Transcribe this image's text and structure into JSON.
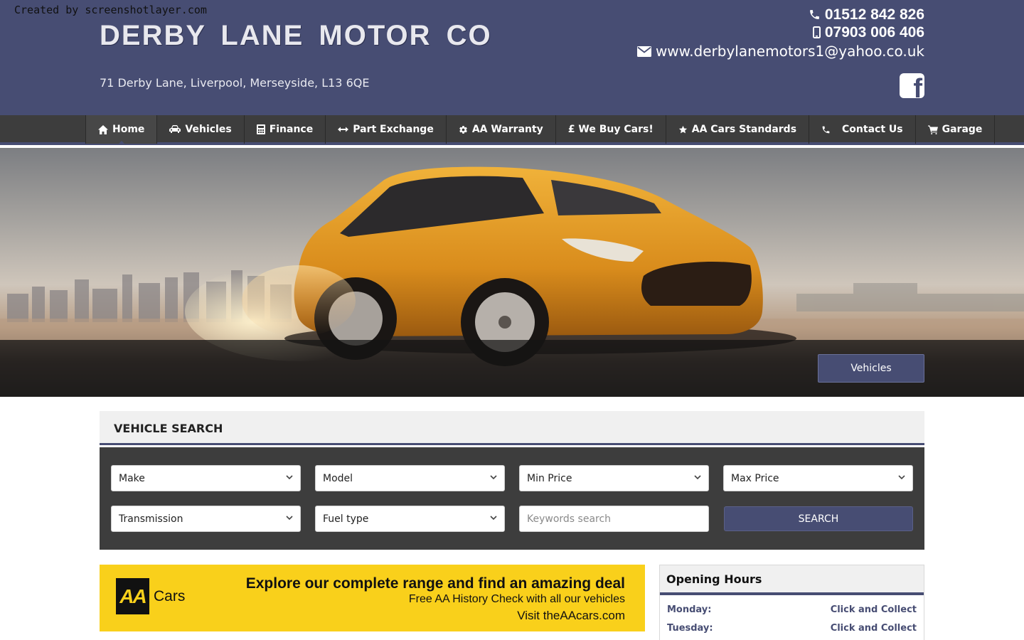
{
  "watermark": "Created by screenshotlayer.com",
  "header": {
    "logo": "DERBY LANE MOTOR CO",
    "address": "71 Derby Lane, Liverpool, Merseyside, L13 6QE",
    "phone1": "01512 842 826",
    "phone2": "07903 006 406",
    "email": "www.derbylanemotors1@yahoo.co.uk",
    "facebook_icon": "facebook-icon"
  },
  "nav": {
    "items": [
      {
        "label": "Home",
        "icon": "home-icon"
      },
      {
        "label": "Vehicles",
        "icon": "car-icon"
      },
      {
        "label": "Finance",
        "icon": "calculator-icon"
      },
      {
        "label": "Part Exchange",
        "icon": "exchange-icon"
      },
      {
        "label": "AA Warranty",
        "icon": "gear-icon"
      },
      {
        "label": "£ We Buy Cars!",
        "icon": ""
      },
      {
        "label": "AA Cars Standards",
        "icon": "star-icon"
      },
      {
        "label": "Contact Us",
        "icon": "phone-icon"
      },
      {
        "label": "Garage",
        "icon": "cart-icon"
      }
    ],
    "active": "Home"
  },
  "hero": {
    "button_label": "Vehicles"
  },
  "vehicle_search": {
    "title": "VEHICLE SEARCH",
    "make": "Make",
    "model": "Model",
    "min_price": "Min Price",
    "max_price": "Max Price",
    "transmission": "Transmission",
    "fuel_type": "Fuel type",
    "keywords_placeholder": "Keywords search",
    "search_label": "SEARCH"
  },
  "aa_banner": {
    "logo": "AA",
    "brand": "Cars",
    "line1": "Explore our complete range and find an amazing deal",
    "line2": "Free AA History Check with all our vehicles",
    "line3": "Visit theAAcars.com"
  },
  "opening_hours": {
    "title": "Opening Hours",
    "rows": [
      {
        "day": "Monday:",
        "value": "Click and Collect"
      },
      {
        "day": "Tuesday:",
        "value": "Click and Collect"
      }
    ]
  },
  "colors": {
    "brand": "#474d73",
    "nav_bg": "#3d3d3d",
    "aa_yellow": "#f9d01b"
  }
}
